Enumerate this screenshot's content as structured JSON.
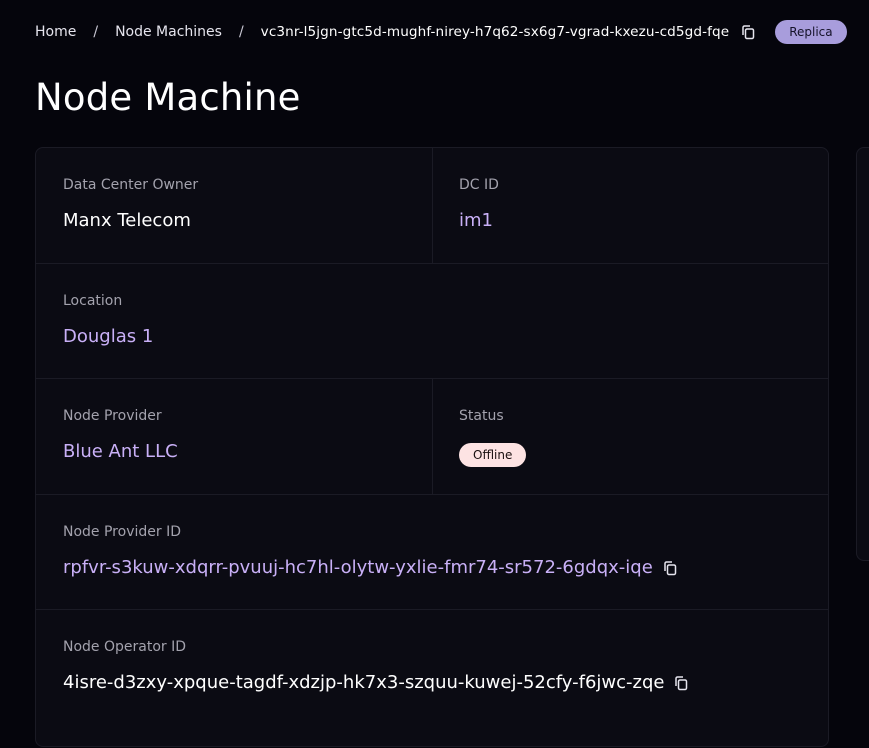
{
  "breadcrumb": {
    "home": "Home",
    "section": "Node Machines",
    "current": "vc3nr-l5jgn-gtc5d-mughf-nirey-h7q62-sx6g7-vgrad-kxezu-cd5gd-fqe",
    "separator": "/",
    "badge": "Replica"
  },
  "page": {
    "title": "Node Machine"
  },
  "details": {
    "dc_owner": {
      "label": "Data Center Owner",
      "value": "Manx Telecom"
    },
    "dc_id": {
      "label": "DC ID",
      "value": "im1"
    },
    "location": {
      "label": "Location",
      "value": "Douglas 1"
    },
    "node_provider": {
      "label": "Node Provider",
      "value": "Blue Ant LLC"
    },
    "status": {
      "label": "Status",
      "value": "Offline"
    },
    "node_provider_id": {
      "label": "Node Provider ID",
      "value": "rpfvr-s3kuw-xdqrr-pvuuj-hc7hl-olytw-yxlie-fmr74-sr572-6gdqx-iqe"
    },
    "node_operator_id": {
      "label": "Node Operator ID",
      "value": "4isre-d3zxy-xpque-tagdf-xdzjp-hk7x3-szquu-kuwej-52cfy-f6jwc-zqe"
    }
  },
  "icons": {
    "copy": "copy-icon"
  },
  "colors": {
    "background": "#05050c",
    "card": "#0b0b13",
    "accent_purple": "#c9b0f7",
    "badge_replica": "#a89ddc",
    "status_offline": "#fde3e3"
  }
}
